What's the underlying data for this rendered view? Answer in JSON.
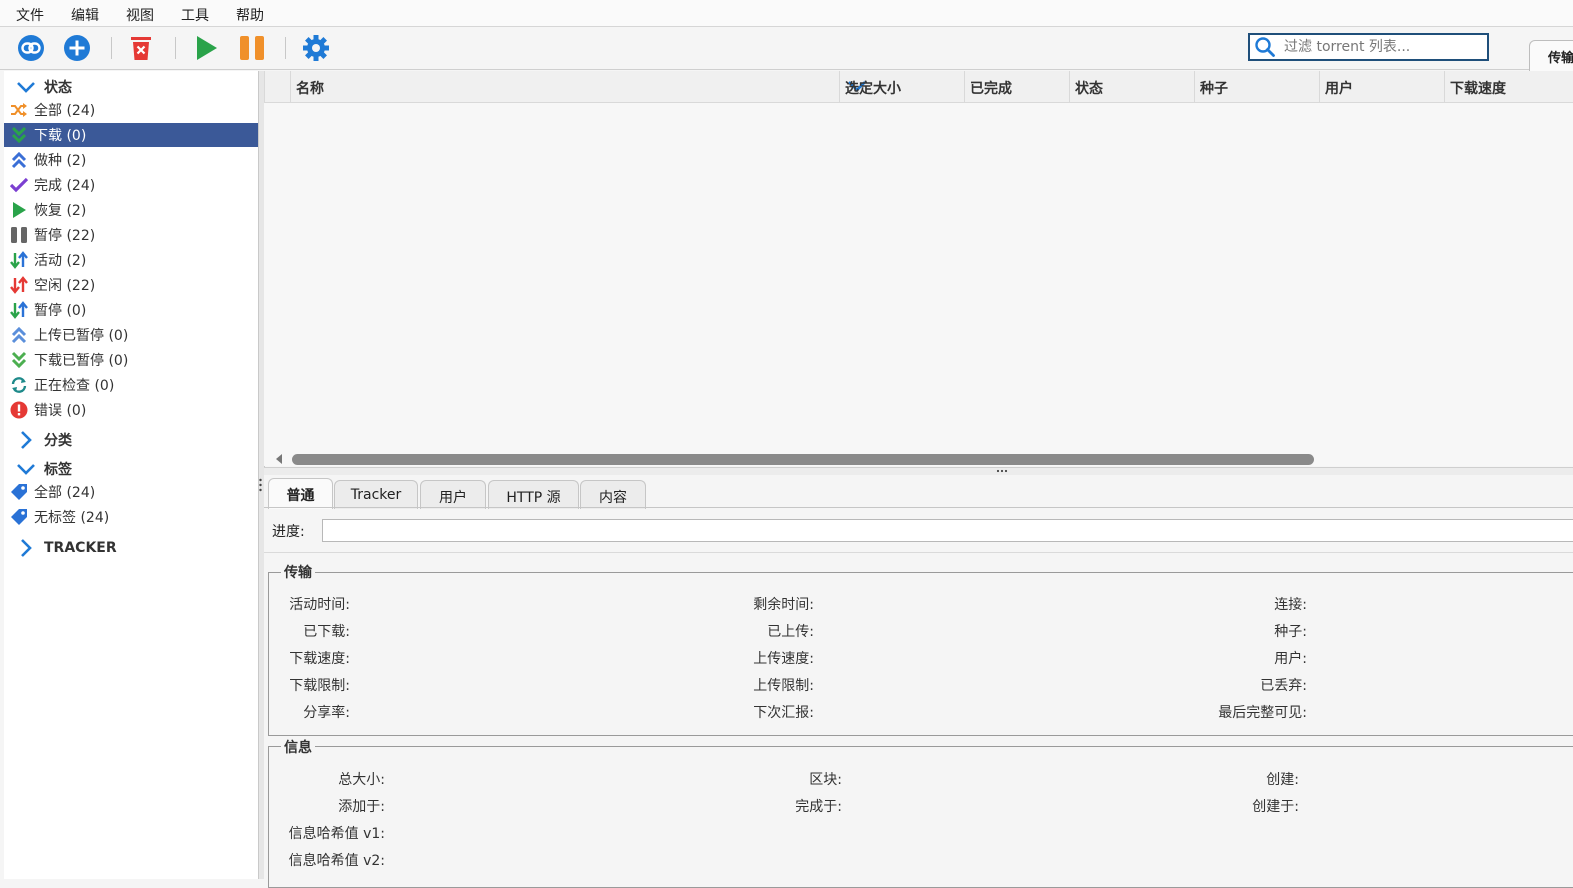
{
  "menu": [
    "文件",
    "编辑",
    "视图",
    "工具",
    "帮助"
  ],
  "search": {
    "placeholder": "过滤 torrent 列表..."
  },
  "right_tab": {
    "label": "传输"
  },
  "sidebar": {
    "status_header": "状态",
    "status_items": [
      {
        "label": "全部 (24)",
        "icon": "shuffle-icon",
        "color": "#f0902a"
      },
      {
        "label": "下载 (0)",
        "icon": "download-icon",
        "color": "#2aa34a"
      },
      {
        "label": "做种 (2)",
        "icon": "seeding-icon",
        "color": "#3b6fd6"
      },
      {
        "label": "完成 (24)",
        "icon": "check-icon",
        "color": "#7b3fd1"
      },
      {
        "label": "恢复 (2)",
        "icon": "play-icon",
        "color": "#2aa34a"
      },
      {
        "label": "暂停 (22)",
        "icon": "pause-icon",
        "color": "#666666"
      },
      {
        "label": "活动 (2)",
        "icon": "active-icon",
        "color": "#2a72d6"
      },
      {
        "label": "空闲 (22)",
        "icon": "inactive-icon",
        "color": "#e53935"
      },
      {
        "label": "暂停 (0)",
        "icon": "stalled-icon",
        "color": "#2a72d6"
      },
      {
        "label": "上传已暂停 (0)",
        "icon": "upload-paused-icon",
        "color": "#5b8fdb"
      },
      {
        "label": "下载已暂停 (0)",
        "icon": "download-paused-icon",
        "color": "#4caf50"
      },
      {
        "label": "正在检查 (0)",
        "icon": "checking-icon",
        "color": "#1e8a8a"
      },
      {
        "label": "错误 (0)",
        "icon": "error-icon",
        "color": "#e53935"
      }
    ],
    "category_header": "分类",
    "tags_header": "标签",
    "tag_items": [
      {
        "label": "全部 (24)",
        "icon": "tag-icon",
        "color": "#2a72d6"
      },
      {
        "label": "无标签 (24)",
        "icon": "tag-icon",
        "color": "#2a72d6"
      }
    ],
    "tracker_header": "TRACKER",
    "selected_index": 1
  },
  "columns": [
    "名称",
    "选定大小",
    "已完成",
    "状态",
    "种子",
    "用户",
    "下载速度"
  ],
  "bottom_tabs": [
    "普通",
    "Tracker",
    "用户",
    "HTTP 源",
    "内容"
  ],
  "general": {
    "progress_label": "进度:",
    "transfer_title": "传输",
    "transfer": [
      [
        "活动时间:",
        "剩余时间:",
        "连接:"
      ],
      [
        "已下载:",
        "已上传:",
        "种子:"
      ],
      [
        "下载速度:",
        "上传速度:",
        "用户:"
      ],
      [
        "下载限制:",
        "上传限制:",
        "已丢弃:"
      ],
      [
        "分享率:",
        "下次汇报:",
        "最后完整可见:"
      ]
    ],
    "info_title": "信息",
    "info": [
      [
        "总大小:",
        "区块:",
        "创建:"
      ],
      [
        "添加于:",
        "完成于:",
        "创建于:"
      ],
      [
        "信息哈希值 v1:",
        "",
        ""
      ],
      [
        "信息哈希值 v2:",
        "",
        ""
      ]
    ]
  },
  "colors": {
    "selected_bg": "#3b5998",
    "accent": "#1f7ad6"
  }
}
